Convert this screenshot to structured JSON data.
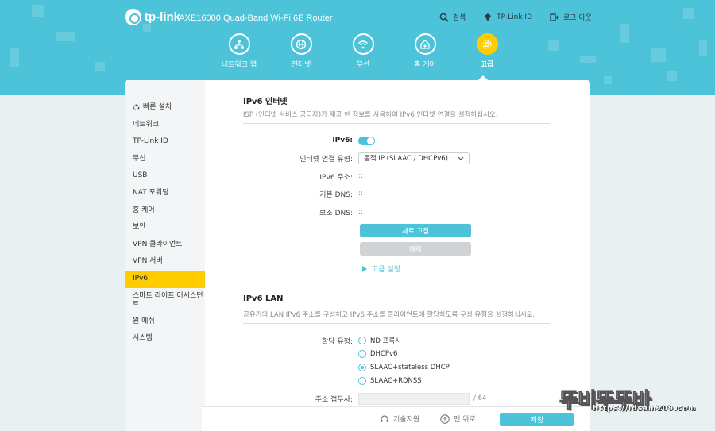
{
  "header": {
    "brand": "tp-link",
    "model": "| AXE16000 Quad-Band Wi-Fi 6E Router",
    "actions": [
      {
        "label": "검색",
        "icon": "search-icon"
      },
      {
        "label": "TP-Link ID",
        "icon": "user-icon"
      },
      {
        "label": "로그 아웃",
        "icon": "logout-icon"
      }
    ]
  },
  "nav": [
    {
      "label": "네트워크 맵",
      "icon": "network-map-icon"
    },
    {
      "label": "인터넷",
      "icon": "globe-icon"
    },
    {
      "label": "무선",
      "icon": "wifi-icon"
    },
    {
      "label": "홈 케어",
      "icon": "home-care-icon"
    },
    {
      "label": "고급",
      "icon": "gear-icon",
      "active": true
    }
  ],
  "sidebar": [
    {
      "label": "빠른 설치",
      "icon": "quick-setup-icon"
    },
    {
      "label": "네트워크"
    },
    {
      "label": "TP-Link ID"
    },
    {
      "label": "무선"
    },
    {
      "label": "USB"
    },
    {
      "label": "NAT 포워딩"
    },
    {
      "label": "홈 케어"
    },
    {
      "label": "보안"
    },
    {
      "label": "VPN 클라이언트"
    },
    {
      "label": "VPN 서버"
    },
    {
      "label": "IPv6",
      "active": true
    },
    {
      "label": "스마트 라이프 어시스턴트"
    },
    {
      "label": "원 메쉬"
    },
    {
      "label": "시스템"
    }
  ],
  "ipv6_internet": {
    "title": "IPv6 인터넷",
    "description": "ISP (인터넷 서비스 공급자)가 제공 한 정보를 사용하여 IPv6 인터넷 연결을 설정하십시오.",
    "ipv6_label": "IPv6:",
    "ipv6_enabled": true,
    "conn_type_label": "인터넷 연결 유형:",
    "conn_type_value": "동적 IP (SLAAC / DHCPv6)",
    "address_label": "IPv6 주소:",
    "address_value": "::",
    "primary_dns_label": "기본 DNS:",
    "primary_dns_value": "::",
    "secondary_dns_label": "보조 DNS:",
    "secondary_dns_value": "::",
    "renew_button": "새로 고침",
    "release_button": "해제",
    "advanced_link": "고급 설정"
  },
  "ipv6_lan": {
    "title": "IPv6 LAN",
    "description": "공유기의 LAN IPv6 주소를 구성하고 IPv6 주소를 클라이언트에 할당하도록 구성 유형을 설정하십시오.",
    "assign_label": "할당 유형:",
    "assign_options": [
      {
        "label": "ND 프록시",
        "selected": false
      },
      {
        "label": "DHCPv6",
        "selected": false
      },
      {
        "label": "SLAAC+stateless DHCP",
        "selected": true
      },
      {
        "label": "SLAAC+RDNSS",
        "selected": false
      }
    ],
    "prefix_label": "주소 접두사:",
    "prefix_value": "",
    "prefix_unit": "/ 64"
  },
  "footer": {
    "support": "기술지원",
    "top": "맨 위로",
    "save": "저장"
  },
  "watermark": {
    "big": "뚜비뚜뚜바",
    "url": "https://idsam209.com"
  },
  "colors": {
    "accent": "#4cc3d9",
    "active": "#ffcc00"
  }
}
